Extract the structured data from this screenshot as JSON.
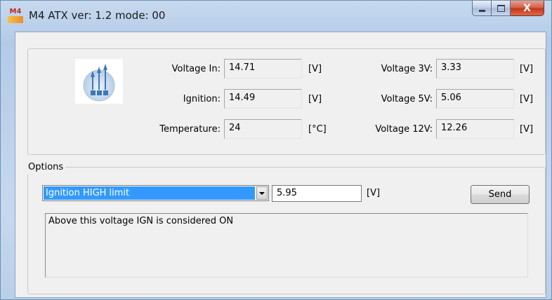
{
  "window": {
    "icon_text": "M4",
    "title": "M4 ATX ver: 1.2 mode: 00"
  },
  "caption_buttons": {
    "close_glyph": "X"
  },
  "readings": {
    "voltage_in": {
      "label": "Voltage In:",
      "value": "14.71",
      "unit": "[V]"
    },
    "ignition": {
      "label": "Ignition:",
      "value": "14.49",
      "unit": "[V]"
    },
    "temperature": {
      "label": "Temperature:",
      "value": "24",
      "unit": "[°C]"
    },
    "voltage_3v": {
      "label": "Voltage 3V:",
      "value": "3.33",
      "unit": "[V]"
    },
    "voltage_5v": {
      "label": "Voltage 5V:",
      "value": "5.06",
      "unit": "[V]"
    },
    "voltage_12v": {
      "label": "Voltage 12V:",
      "value": "12.26",
      "unit": "[V]"
    }
  },
  "options": {
    "legend": "Options",
    "selected_option": "Ignition HIGH limit",
    "limit_value": "5.95",
    "limit_unit": "[V]",
    "send_label": "Send",
    "description": "Above this voltage IGN is considered ON"
  },
  "colors": {
    "selection": "#3399ff",
    "close_button": "#c1361b",
    "title_gradient": "#b9cfe9"
  }
}
